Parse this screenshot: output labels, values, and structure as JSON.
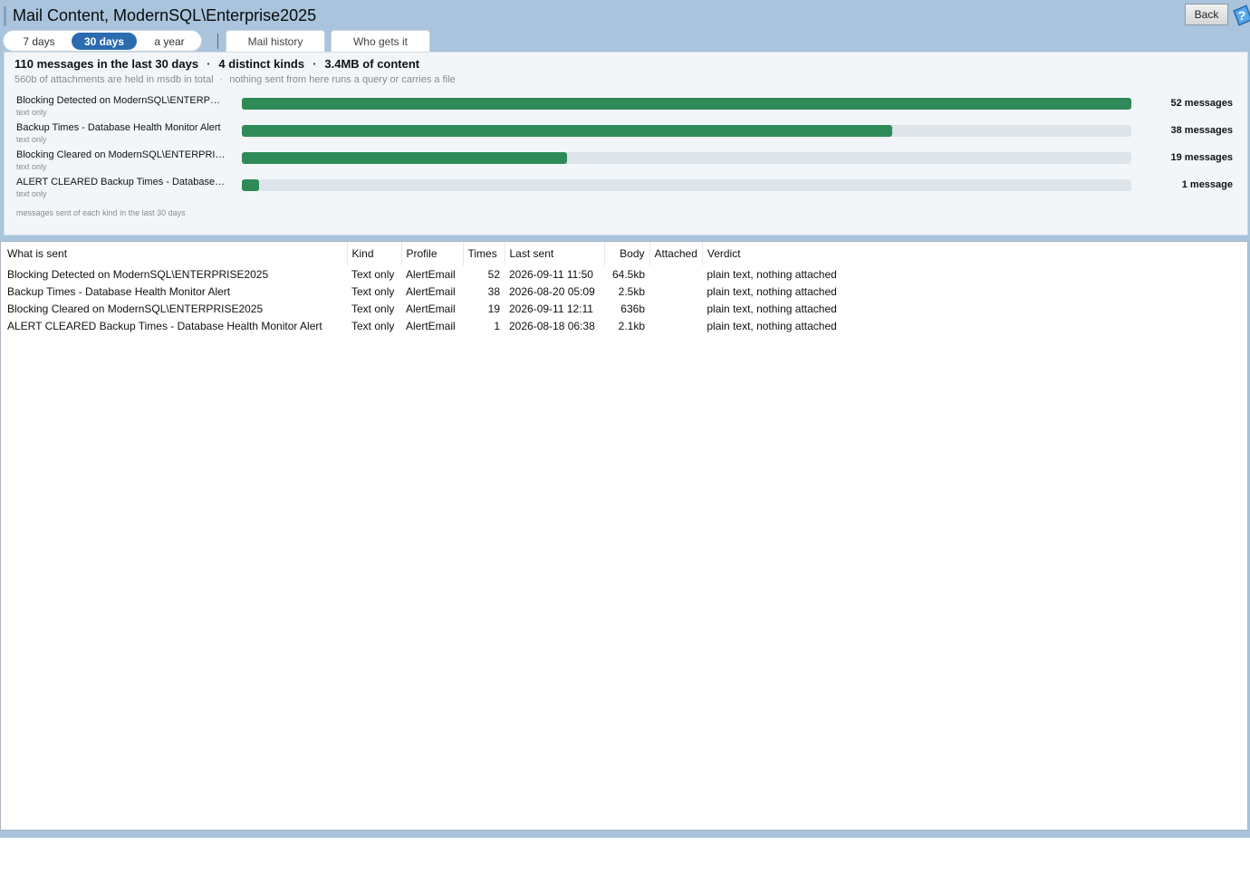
{
  "window": {
    "title": "Mail Content, ModernSQL\\Enterprise2025",
    "back_label": "Back",
    "help_icon": "help-icon"
  },
  "range_tabs": [
    {
      "label": "7 days",
      "active": false
    },
    {
      "label": "30 days",
      "active": true
    },
    {
      "label": "a year",
      "active": false
    }
  ],
  "view_tabs": [
    {
      "label": "Mail history"
    },
    {
      "label": "Who gets it"
    }
  ],
  "summary": {
    "headline": {
      "messages": "110 messages in the last 30 days",
      "kinds": "4 distinct kinds",
      "content": "3.4MB of content",
      "separator": "·"
    },
    "subline": {
      "attachments": "560b of attachments are held in msdb in total",
      "separator": "·",
      "note": "nothing sent from here runs a query or carries a file"
    },
    "bar_color": "#2e8b57",
    "bars": [
      {
        "label": "Blocking Detected on ModernSQL\\ENTERPRISE2025",
        "sub": "text only",
        "value": 52,
        "count_label": "52 messages"
      },
      {
        "label": "Backup Times - Database Health Monitor Alert",
        "sub": "text only",
        "value": 38,
        "count_label": "38 messages"
      },
      {
        "label": "Blocking Cleared on ModernSQL\\ENTERPRISE2025",
        "sub": "text only",
        "value": 19,
        "count_label": "19 messages"
      },
      {
        "label": "ALERT CLEARED Backup Times - Database Health Monitor Alert",
        "sub": "text only",
        "value": 1,
        "count_label": "1 message"
      }
    ],
    "bar_max": 52,
    "caption": "messages sent of each kind in the last 30 days"
  },
  "table": {
    "columns": [
      "What is sent",
      "Kind",
      "Profile",
      "Times",
      "Last sent",
      "Body",
      "Attached",
      "Verdict"
    ],
    "rows": [
      {
        "what": "Blocking Detected on ModernSQL\\ENTERPRISE2025",
        "kind": "Text only",
        "profile": "AlertEmail",
        "times": "52",
        "last_sent": "2026-09-11 11:50",
        "body": "64.5kb",
        "attached": "",
        "verdict": "plain text, nothing attached"
      },
      {
        "what": "Backup Times - Database Health Monitor Alert",
        "kind": "Text only",
        "profile": "AlertEmail",
        "times": "38",
        "last_sent": "2026-08-20 05:09",
        "body": "2.5kb",
        "attached": "",
        "verdict": "plain text, nothing attached"
      },
      {
        "what": "Blocking Cleared on ModernSQL\\ENTERPRISE2025",
        "kind": "Text only",
        "profile": "AlertEmail",
        "times": "19",
        "last_sent": "2026-09-11 12:11",
        "body": "636b",
        "attached": "",
        "verdict": "plain text, nothing attached"
      },
      {
        "what": "ALERT CLEARED Backup Times - Database Health Monitor Alert",
        "kind": "Text only",
        "profile": "AlertEmail",
        "times": "1",
        "last_sent": "2026-08-18 06:38",
        "body": "2.1kb",
        "attached": "",
        "verdict": "plain text, nothing attached"
      }
    ]
  }
}
